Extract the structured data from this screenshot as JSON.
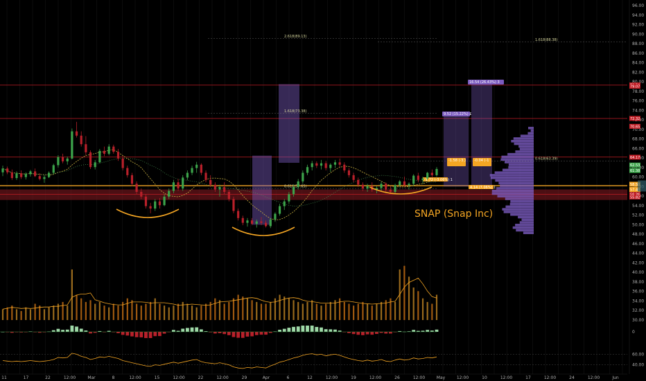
{
  "chart_data": {
    "type": "candlestick",
    "title": "SNAP (Snap Inc)",
    "colors": {
      "background": "#000000",
      "up": "#3ca34a",
      "down": "#b8202a",
      "accent": "#f5a623",
      "resistance": "#c21d25",
      "purple": "#7b5bbf",
      "volume_ma": "#f5a623"
    },
    "price_axis": {
      "ylim": [
        47,
        98
      ],
      "ticks": [
        "96.00",
        "94.00",
        "92.00",
        "90.00",
        "88.00",
        "86.00",
        "84.00",
        "82.00",
        "80.00",
        "78.00",
        "76.00",
        "74.00",
        "72.00",
        "70.00",
        "68.00",
        "66.00",
        "64.00",
        "62.00",
        "60.00",
        "58.00",
        "56.00",
        "54.00",
        "52.00",
        "50.00",
        "48.00",
        "46.00",
        "44.00",
        "42.00",
        "40.00",
        "38.00",
        "36.00",
        "34.00",
        "32.00",
        "30.00"
      ]
    },
    "rsi_axis": {
      "ticks": [
        "60.00",
        "40.00"
      ]
    },
    "macd_axis": {
      "ticks": [
        "0"
      ]
    },
    "time_axis": {
      "labels": [
        "11",
        "17",
        "22",
        "12:00",
        "Mar",
        "8",
        "12:00",
        "15",
        "12:00",
        "22",
        "12:00",
        "29",
        "Apr",
        "6",
        "12",
        "12:00",
        "19",
        "12:00",
        "26",
        "12:00",
        "May",
        "12:00",
        "10",
        "12:00",
        "17",
        "12:00",
        "24",
        "12:00",
        "Jun"
      ]
    },
    "price_tags": [
      {
        "value": "79.34",
        "color": "#c21d25"
      },
      {
        "value": "79.07",
        "color": "#c21d25"
      },
      {
        "value": "72.32",
        "color": "#c21d25"
      },
      {
        "value": "70.65",
        "color": "#c21d25"
      },
      {
        "value": "64.17",
        "color": "#c21d25"
      },
      {
        "value": "62.53",
        "color": "#3ca34a"
      },
      {
        "value": "61.38",
        "color": "#3ca34a"
      },
      {
        "value": "58.50",
        "color": "#f5a623"
      },
      {
        "value": "57.40",
        "color": "#f5a623"
      },
      {
        "value": "56.36",
        "color": "#c21d25"
      },
      {
        "value": "55.82",
        "color": "#c21d25"
      }
    ],
    "fib_labels": [
      {
        "text": "2.618(89.13)",
        "price": 89.1
      },
      {
        "text": "1.618(73.38)",
        "price": 73.4
      },
      {
        "text": "0.618(57.65)",
        "price": 57.6
      },
      {
        "text": "1.618(88.38)",
        "price": 88.4
      },
      {
        "text": "0.618(63.39)",
        "price": 63.4
      }
    ],
    "measure_boxes": [
      {
        "text": "9.52 (15.22%) £"
      },
      {
        "text": "16.54 (26.43%) 3"
      },
      {
        "text": "-1.58 (-3.)"
      },
      {
        "text": "-0.04 (-1"
      },
      {
        "text": "-1.72 (-3.06%) 1"
      },
      {
        "text": "4.14 (7.06%) 1"
      }
    ],
    "candles": [
      [
        61,
        62.4,
        60.2,
        61.8
      ],
      [
        61.8,
        62.2,
        60.6,
        61.0
      ],
      [
        61,
        61.6,
        59.4,
        59.8
      ],
      [
        59.8,
        61.2,
        59.4,
        60.8
      ],
      [
        60.8,
        61.4,
        59.6,
        60.0
      ],
      [
        60,
        61.0,
        59.5,
        60.6
      ],
      [
        60.6,
        61.5,
        60.1,
        61.2
      ],
      [
        61.2,
        61.8,
        60.0,
        60.2
      ],
      [
        60.2,
        60.8,
        59.3,
        59.6
      ],
      [
        59.6,
        60.4,
        58.8,
        60.0
      ],
      [
        60,
        61.2,
        59.8,
        60.9
      ],
      [
        60.9,
        62.8,
        60.6,
        62.5
      ],
      [
        62.5,
        64.6,
        62.0,
        64.2
      ],
      [
        64.2,
        64.9,
        62.9,
        63.3
      ],
      [
        63.3,
        64.3,
        62.6,
        63.9
      ],
      [
        63.9,
        70.2,
        63.7,
        69.6
      ],
      [
        69.6,
        71.6,
        68.3,
        68.7
      ],
      [
        68.7,
        69.6,
        66.4,
        66.9
      ],
      [
        66.9,
        68.6,
        64.6,
        65.2
      ],
      [
        65.2,
        65.6,
        61.7,
        62.1
      ],
      [
        62.1,
        63.6,
        61.6,
        63.1
      ],
      [
        63.1,
        65.9,
        62.9,
        65.5
      ],
      [
        65.5,
        66.4,
        64.4,
        64.9
      ],
      [
        64.9,
        66.9,
        64.6,
        66.4
      ],
      [
        66.4,
        66.8,
        64.9,
        65.3
      ],
      [
        65.3,
        65.9,
        63.4,
        63.9
      ],
      [
        63.9,
        64.4,
        61.4,
        61.9
      ],
      [
        61.9,
        62.4,
        59.9,
        60.4
      ],
      [
        60.4,
        60.9,
        58.1,
        58.6
      ],
      [
        58.6,
        59.1,
        56.4,
        56.9
      ],
      [
        56.9,
        57.6,
        55.4,
        55.9
      ],
      [
        55.9,
        56.4,
        53.4,
        53.9
      ],
      [
        53.9,
        54.6,
        52.4,
        53.4
      ],
      [
        53.4,
        55.4,
        52.9,
        54.9
      ],
      [
        54.9,
        55.6,
        53.4,
        54.1
      ],
      [
        54.1,
        56.4,
        53.9,
        55.9
      ],
      [
        55.9,
        57.6,
        55.4,
        57.1
      ],
      [
        57.1,
        59.4,
        56.6,
        58.9
      ],
      [
        58.9,
        59.6,
        57.1,
        57.6
      ],
      [
        57.6,
        60.4,
        57.1,
        59.9
      ],
      [
        59.9,
        61.4,
        59.4,
        60.9
      ],
      [
        60.9,
        62.4,
        60.4,
        61.9
      ],
      [
        61.9,
        63.2,
        60.9,
        62.6
      ],
      [
        62.6,
        62.9,
        60.4,
        60.9
      ],
      [
        60.9,
        61.4,
        58.9,
        59.4
      ],
      [
        59.4,
        60.4,
        57.9,
        58.4
      ],
      [
        58.4,
        58.9,
        56.9,
        57.4
      ],
      [
        57.4,
        58.4,
        55.9,
        57.9
      ],
      [
        57.9,
        58.9,
        56.4,
        56.9
      ],
      [
        56.9,
        57.4,
        54.9,
        55.4
      ],
      [
        55.4,
        55.9,
        52.4,
        52.9
      ],
      [
        52.9,
        53.4,
        50.9,
        51.4
      ],
      [
        51.4,
        51.9,
        49.9,
        50.4
      ],
      [
        50.4,
        51.4,
        49.6,
        50.9
      ],
      [
        50.9,
        51.4,
        49.9,
        50.2
      ],
      [
        50.2,
        51.1,
        49.4,
        50.7
      ],
      [
        50.7,
        51.6,
        49.9,
        50.4
      ],
      [
        50.4,
        50.9,
        49.4,
        49.7
      ],
      [
        49.7,
        51.4,
        49.3,
        51.1
      ],
      [
        51.1,
        52.6,
        50.6,
        52.3
      ],
      [
        52.3,
        54.4,
        51.9,
        53.9
      ],
      [
        53.9,
        55.4,
        53.1,
        54.9
      ],
      [
        54.9,
        56.9,
        54.4,
        56.4
      ],
      [
        56.4,
        58.4,
        55.9,
        57.9
      ],
      [
        57.9,
        59.6,
        57.4,
        59.1
      ],
      [
        59.1,
        61.4,
        58.6,
        60.9
      ],
      [
        60.9,
        62.6,
        60.4,
        62.1
      ],
      [
        62.1,
        63.4,
        61.4,
        62.9
      ],
      [
        62.9,
        63.3,
        61.9,
        62.4
      ],
      [
        62.4,
        63.6,
        61.6,
        62.9
      ],
      [
        62.9,
        63.4,
        61.4,
        61.9
      ],
      [
        61.9,
        62.9,
        61.1,
        62.6
      ],
      [
        62.6,
        63.6,
        61.9,
        63.1
      ],
      [
        63.1,
        63.9,
        62.1,
        62.6
      ],
      [
        62.6,
        63.1,
        60.9,
        61.4
      ],
      [
        61.4,
        61.9,
        59.9,
        60.4
      ],
      [
        60.4,
        60.9,
        58.9,
        59.4
      ],
      [
        59.4,
        59.9,
        57.9,
        58.4
      ],
      [
        58.4,
        58.9,
        57.1,
        57.6
      ],
      [
        57.6,
        58.6,
        56.9,
        58.1
      ],
      [
        58.1,
        58.9,
        56.9,
        57.3
      ],
      [
        57.3,
        58.1,
        56.6,
        57.7
      ],
      [
        57.7,
        59.1,
        57.1,
        58.6
      ],
      [
        58.6,
        58.9,
        56.9,
        57.4
      ],
      [
        57.4,
        58.1,
        56.4,
        56.9
      ],
      [
        56.9,
        58.6,
        56.6,
        58.3
      ],
      [
        58.3,
        59.4,
        57.9,
        59.1
      ],
      [
        59.1,
        60.1,
        57.9,
        58.3
      ],
      [
        58.3,
        58.9,
        57.4,
        58.6
      ],
      [
        58.6,
        60.6,
        58.1,
        60.3
      ],
      [
        60.3,
        60.9,
        58.9,
        59.4
      ],
      [
        59.4,
        60.1,
        58.6,
        59.7
      ],
      [
        59.7,
        61.1,
        59.3,
        60.9
      ],
      [
        60.9,
        61.6,
        59.9,
        60.4
      ],
      [
        60.4,
        62.1,
        60.1,
        61.7
      ]
    ],
    "volume": [
      6,
      7,
      8,
      6,
      5,
      7,
      6,
      9,
      8,
      6,
      7,
      8,
      9,
      10,
      8,
      28,
      14,
      12,
      10,
      11,
      9,
      10,
      8,
      7,
      9,
      8,
      10,
      12,
      11,
      9,
      8,
      9,
      10,
      12,
      9,
      8,
      7,
      8,
      9,
      10,
      9,
      8,
      7,
      8,
      9,
      10,
      12,
      11,
      9,
      10,
      12,
      14,
      13,
      12,
      11,
      10,
      9,
      9,
      10,
      12,
      14,
      13,
      12,
      11,
      10,
      9,
      10,
      11,
      9,
      8,
      9,
      10,
      11,
      12,
      10,
      9,
      8,
      9,
      10,
      9,
      8,
      9,
      10,
      11,
      12,
      10,
      28,
      30,
      24,
      18,
      16,
      12,
      10,
      9,
      14
    ],
    "volume_ylim": [
      0,
      46
    ],
    "rsi": [
      48,
      47,
      46,
      47,
      46,
      47,
      48,
      47,
      46,
      47,
      48,
      50,
      54,
      53,
      54,
      62,
      60,
      56,
      54,
      50,
      52,
      55,
      54,
      56,
      54,
      52,
      48,
      46,
      44,
      42,
      40,
      38,
      37,
      40,
      39,
      41,
      43,
      45,
      43,
      45,
      47,
      49,
      50,
      46,
      44,
      43,
      42,
      44,
      42,
      40,
      36,
      34,
      33,
      35,
      34,
      36,
      35,
      34,
      38,
      41,
      45,
      47,
      50,
      53,
      55,
      58,
      60,
      61,
      59,
      60,
      57,
      59,
      60,
      58,
      55,
      52,
      50,
      48,
      47,
      49,
      47,
      48,
      50,
      47,
      46,
      49,
      51,
      49,
      50,
      53,
      51,
      52,
      54,
      53,
      55
    ],
    "rsi_ylim": [
      25,
      75
    ]
  }
}
